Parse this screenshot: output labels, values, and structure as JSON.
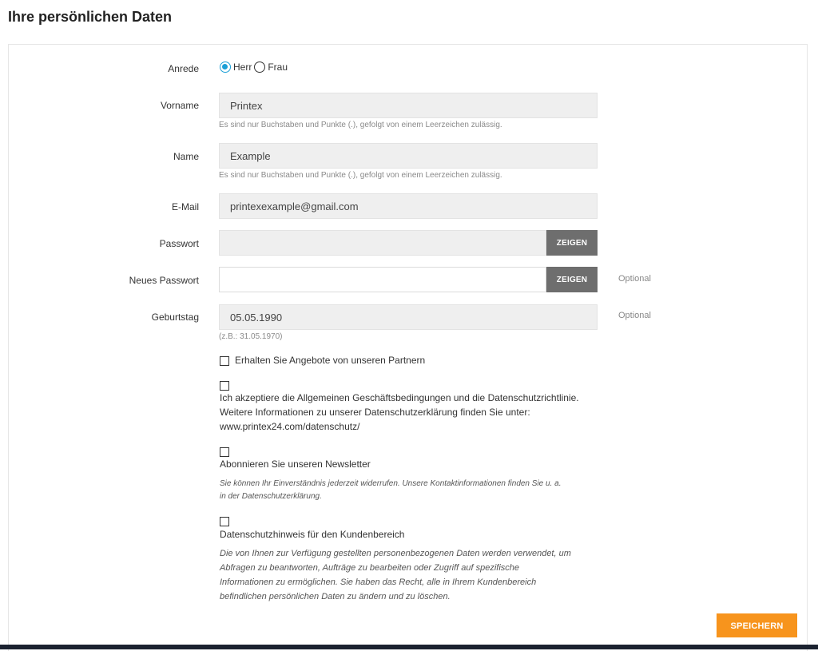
{
  "page_title": "Ihre persönlichen Daten",
  "salutation": {
    "label": "Anrede",
    "options": [
      "Herr",
      "Frau"
    ],
    "selected": "Herr"
  },
  "first_name": {
    "label": "Vorname",
    "value": "Printex",
    "hint": "Es sind nur Buchstaben und Punkte (.), gefolgt von einem Leerzeichen zulässig."
  },
  "last_name": {
    "label": "Name",
    "value": "Example",
    "hint": "Es sind nur Buchstaben und Punkte (.), gefolgt von einem Leerzeichen zulässig."
  },
  "email": {
    "label": "E-Mail",
    "value": "printexexample@gmail.com"
  },
  "password": {
    "label": "Passwort",
    "value": "",
    "show_label": "ZEIGEN"
  },
  "new_password": {
    "label": "Neues Passwort",
    "value": "",
    "show_label": "ZEIGEN",
    "optional_label": "Optional"
  },
  "birthday": {
    "label": "Geburtstag",
    "value": "05.05.1990",
    "optional_label": "Optional",
    "hint": "(z.B.: 31.05.1970)"
  },
  "checkboxes": {
    "partners": {
      "text": "Erhalten Sie Angebote von unseren Partnern",
      "checked": false
    },
    "terms": {
      "lines": [
        "Ich akzeptiere die Allgemeinen Geschäftsbedingungen und die Datenschutzrichtlinie.",
        "Weitere Informationen zu unserer Datenschutzerklärung finden Sie unter:",
        "www.printex24.com/datenschutz/"
      ],
      "checked": false
    },
    "newsletter": {
      "text": "Abonnieren Sie unseren Newsletter",
      "note_lines": [
        "Sie können Ihr Einverständnis jederzeit widerrufen. Unsere Kontaktinformationen finden Sie u. a.",
        "in der Datenschutzerklärung."
      ],
      "checked": false
    },
    "privacy": {
      "text": "Datenschutzhinweis für den Kundenbereich",
      "note_lines": [
        "Die von Ihnen zur Verfügung gestellten personenbezogenen Daten werden verwendet, um",
        "Abfragen zu beantworten, Aufträge zu bearbeiten oder Zugriff auf spezifische",
        "Informationen zu ermöglichen. Sie haben das Recht, alle in Ihrem Kundenbereich",
        "befindlichen persönlichen Daten zu ändern und zu löschen."
      ],
      "checked": false
    }
  },
  "save_label": "SPEICHERN",
  "colors": {
    "accent": "#f7941d",
    "radio": "#1a9fd6",
    "show_button": "#6e6e6e",
    "input_bg": "#efefef"
  }
}
